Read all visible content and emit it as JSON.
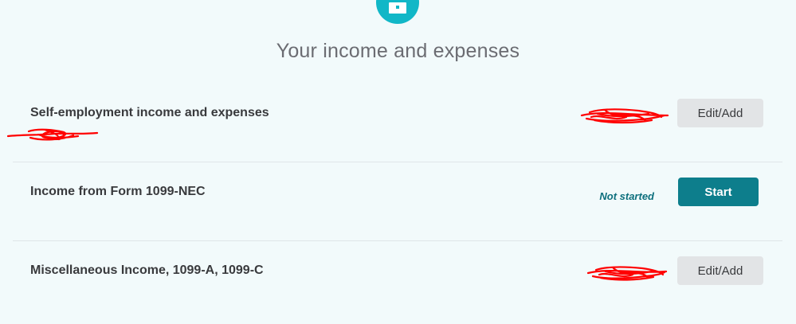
{
  "header": {
    "title": "Your income and expenses",
    "icon": "briefcase-icon"
  },
  "rows": [
    {
      "label": "Self-employment income and expenses",
      "action": "Edit/Add",
      "status": ""
    },
    {
      "label": "Income from Form 1099-NEC",
      "action": "Start",
      "status": "Not started"
    },
    {
      "label": "Miscellaneous Income, 1099-A, 1099-C",
      "action": "Edit/Add",
      "status": ""
    }
  ],
  "colors": {
    "background": "#f2fafb",
    "accent": "#11b7c7",
    "primary_button": "#0d7e8c",
    "secondary_button": "#e2e4e6",
    "redaction": "#ff0000"
  }
}
